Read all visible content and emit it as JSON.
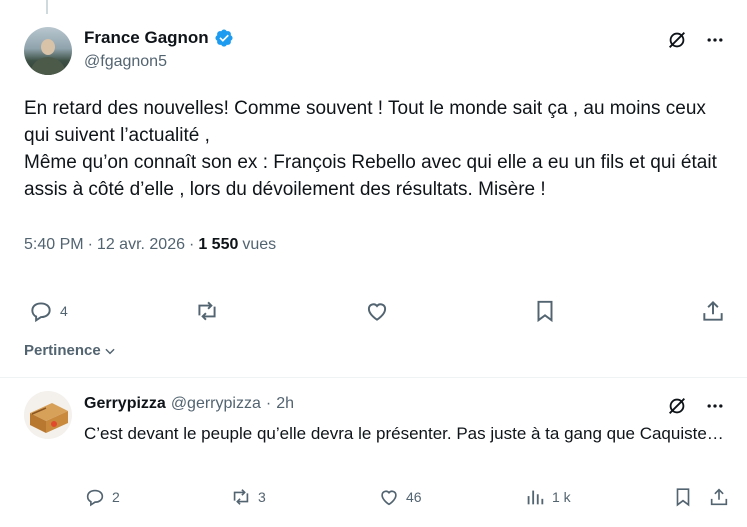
{
  "main_tweet": {
    "display_name": "France Gagnon",
    "handle": "@fgagnon5",
    "text_lines": [
      "En retard des nouvelles! Comme souvent ! Tout le monde sait ça , au moins ceux qui suivent l’actualité ,",
      "Même qu’on connaît son ex : François Rebello avec qui elle a eu un fils et qui était assis à côté d’elle , lors du dévoilement des résultats. Misère !"
    ],
    "time": "5:40 PM",
    "date": "12 avr. 2026",
    "views_count": "1 550",
    "views_label": "vues",
    "replies": "4",
    "reposts": "",
    "likes": ""
  },
  "sort": {
    "label": "Pertinence"
  },
  "reply": {
    "display_name": "Gerrypizza",
    "handle": "@gerrypizza",
    "time": "2h",
    "text": "C’est devant le peuple qu’elle devra le présenter. Pas juste à ta gang que Caquiste…",
    "replies": "2",
    "reposts": "3",
    "likes": "46",
    "views": "1 k"
  },
  "colors": {
    "accent": "#1d9bf0",
    "muted": "#536471",
    "text": "#0f1419"
  }
}
